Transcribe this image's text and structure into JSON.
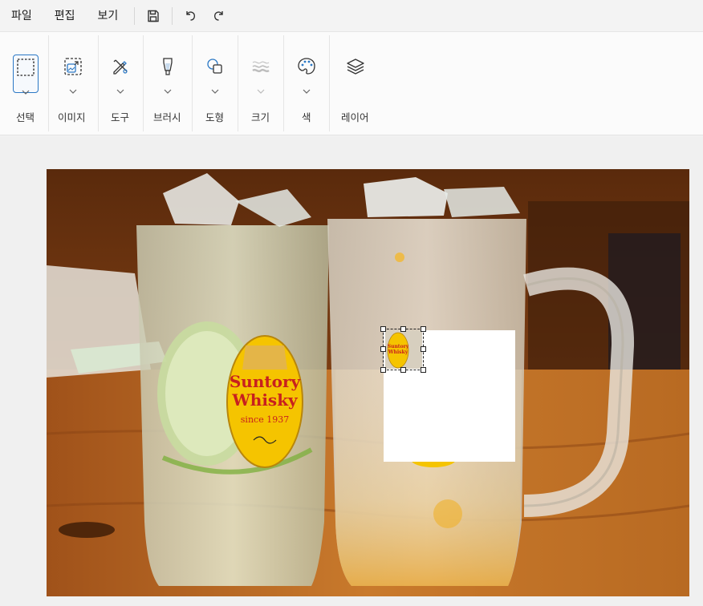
{
  "menubar": {
    "file": "파일",
    "edit": "편집",
    "view": "보기"
  },
  "quick_actions": {
    "save_icon": "save-icon",
    "undo_icon": "undo-icon",
    "redo_icon": "redo-icon"
  },
  "ribbon": {
    "groups": [
      {
        "label": "선택",
        "icon": "selection-rect-icon",
        "active": true
      },
      {
        "label": "이미지",
        "icon": "image-resize-icon"
      },
      {
        "label": "도구",
        "icon": "tools-icon"
      },
      {
        "label": "브러시",
        "icon": "brush-icon"
      },
      {
        "label": "도형",
        "icon": "shapes-icon"
      },
      {
        "label": "크기",
        "icon": "stroke-size-icon",
        "disabled": true
      },
      {
        "label": "색",
        "icon": "palette-icon"
      },
      {
        "label": "레이어",
        "icon": "layers-icon"
      }
    ]
  },
  "canvas": {
    "label_brand_line1": "Suntory",
    "label_brand_line2": "Whisky",
    "label_since": "since 1937",
    "mini_label_line1": "Suntory",
    "mini_label_line2": "Whisky"
  },
  "colors": {
    "accent": "#2b78c5",
    "menubar_bg": "#f3f3f3",
    "ribbon_bg": "#fbfbfb",
    "label_yellow": "#f5c400",
    "label_red": "#c8201e"
  }
}
